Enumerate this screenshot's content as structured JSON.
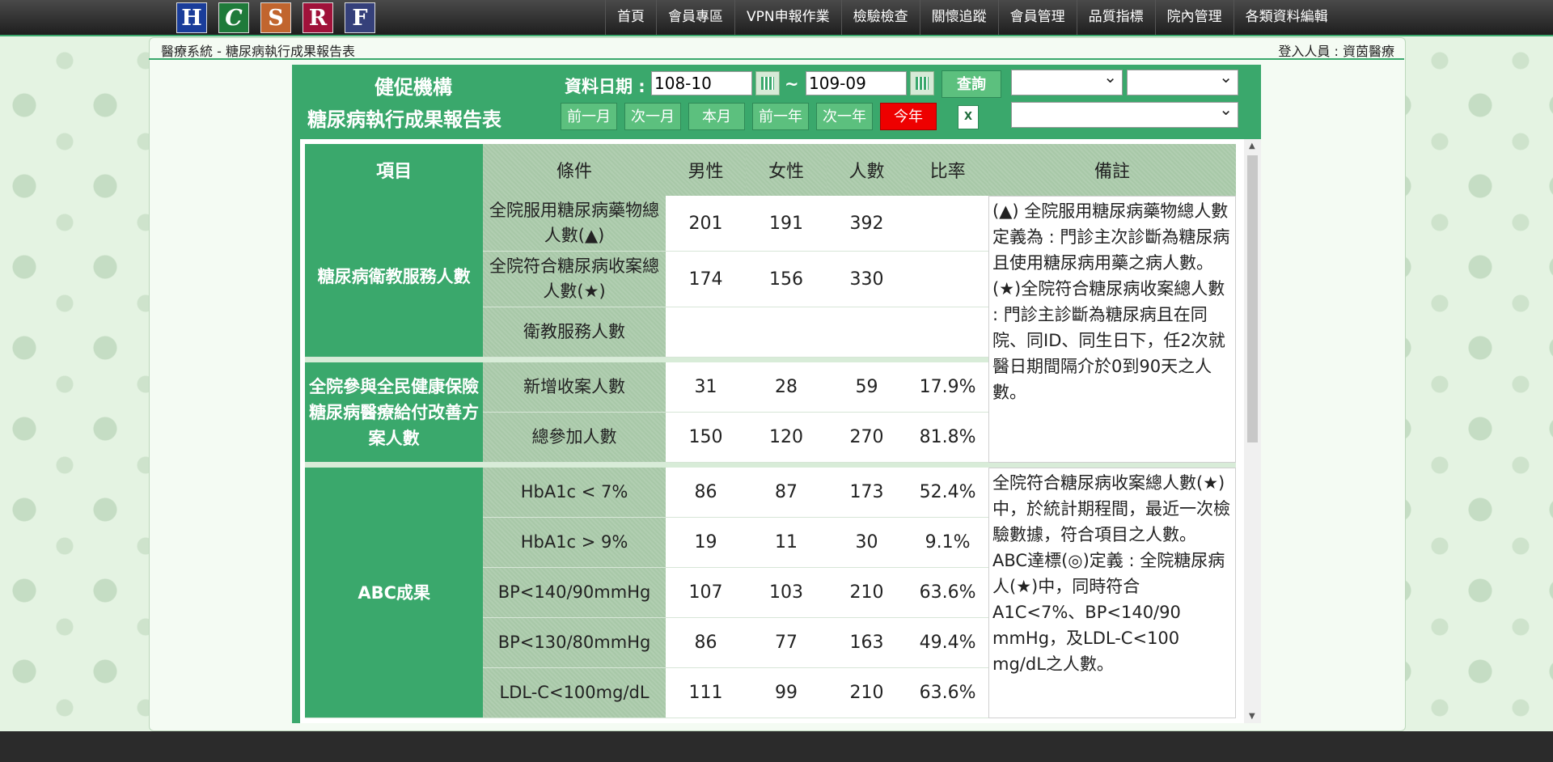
{
  "nav": {
    "logos": [
      {
        "letter": "H",
        "color": "#1a3d9a"
      },
      {
        "letter": "C",
        "color": "#1f7a3a"
      },
      {
        "letter": "S",
        "color": "#c1652e"
      },
      {
        "letter": "R",
        "color": "#a0123a"
      },
      {
        "letter": "F",
        "color": "#35407a"
      }
    ],
    "links": [
      "首頁",
      "會員專區",
      "VPN申報作業",
      "檢驗檢查",
      "關懷追蹤",
      "會員管理",
      "品質指標",
      "院內管理",
      "各類資料編輯"
    ]
  },
  "breadcrumb": "醫療系統 - 糖尿病執行成果報告表",
  "user": "登入人員 : 資茵醫療",
  "report": {
    "org": "健促機構",
    "title": "糖尿病執行成果報告表",
    "date_label": "資料日期 :",
    "date_from": "108-10",
    "date_sep": "~",
    "date_to": "109-09",
    "query_btn": "查詢",
    "period_btns": [
      "前一月",
      "次一月",
      "本月",
      "前一年",
      "次一年",
      "今年"
    ]
  },
  "table": {
    "headers": [
      "項目",
      "條件",
      "男性",
      "女性",
      "人數",
      "比率",
      "備註"
    ],
    "group1": {
      "item": "糖尿病衛教服務人數",
      "rows": [
        {
          "cond": "全院服用糖尿病藥物總人數(▲)",
          "male": "201",
          "female": "191",
          "total": "392",
          "rate": ""
        },
        {
          "cond": "全院符合糖尿病收案總人數(★)",
          "male": "174",
          "female": "156",
          "total": "330",
          "rate": ""
        },
        {
          "cond": "衛教服務人數",
          "male": "",
          "female": "",
          "total": "",
          "rate": ""
        }
      ]
    },
    "group2": {
      "item": "全院參與全民健康保險糖尿病醫療給付改善方案人數",
      "rows": [
        {
          "cond": "新增收案人數",
          "male": "31",
          "female": "28",
          "total": "59",
          "rate": "17.9%"
        },
        {
          "cond": "總參加人數",
          "male": "150",
          "female": "120",
          "total": "270",
          "rate": "81.8%"
        }
      ]
    },
    "note1": "(▲) 全院服用糖尿病藥物總人數定義為 : 門診主次診斷為糖尿病且使用糖尿病用藥之病人數。\n(★)全院符合糖尿病收案總人數 : 門診主診斷為糖尿病且在同院、同ID、同生日下，任2次就醫日期間隔介於0到90天之人數。",
    "group3": {
      "item": "ABC成果",
      "rows": [
        {
          "cond": "HbA1c < 7%",
          "male": "86",
          "female": "87",
          "total": "173",
          "rate": "52.4%"
        },
        {
          "cond": "HbA1c > 9%",
          "male": "19",
          "female": "11",
          "total": "30",
          "rate": "9.1%"
        },
        {
          "cond": "BP<140/90mmHg",
          "male": "107",
          "female": "103",
          "total": "210",
          "rate": "63.6%"
        },
        {
          "cond": "BP<130/80mmHg",
          "male": "86",
          "female": "77",
          "total": "163",
          "rate": "49.4%"
        },
        {
          "cond": "LDL-C<100mg/dL",
          "male": "111",
          "female": "99",
          "total": "210",
          "rate": "63.6%"
        }
      ]
    },
    "note2": "全院符合糖尿病收案總人數(★)中，於統計期程間，最近一次檢驗數據，符合項目之人數。\nABC達標(◎)定義 : 全院糖尿病人(★)中，同時符合A1C<7%、BP<140/90 mmHg，及LDL-C<100 mg/dL之人數。"
  }
}
